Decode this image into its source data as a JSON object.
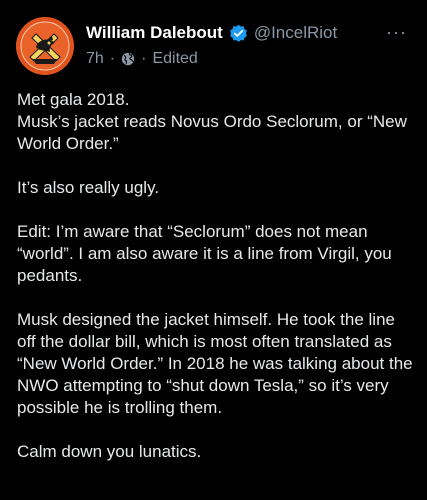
{
  "post": {
    "author": {
      "display_name": "William Dalebout",
      "handle": "@IncelRiot",
      "verified_icon": "verified-badge-icon",
      "avatar_icon": "avatar-logo-icon"
    },
    "meta": {
      "time": "7h",
      "separator": "·",
      "audience_icon": "globe-icon",
      "edited_label": "Edited"
    },
    "more_label": "···",
    "body": {
      "line1": "Met gala 2018.",
      "line2": "Musk’s jacket reads Novus Ordo Seclorum, or “New World Order.”",
      "para2": "It’s also really ugly.",
      "para3": "Edit: I’m aware that “Seclorum” does not mean “world”. I am also aware it is a line from Virgil, you pedants.",
      "para4": "Musk designed the jacket himself. He took the line off the dollar bill, which is most often translated as “New World Order.” In 2018 he was talking about the NWO attempting to “shut down Tesla,” so it’s very possible he is trolling them.",
      "para5": "Calm down you lunatics."
    },
    "colors": {
      "background": "#000000",
      "text": "#e7e9ea",
      "secondary_text": "#8b98a5",
      "verified_blue": "#1d9bf0",
      "avatar_orange": "#e0531f"
    }
  }
}
